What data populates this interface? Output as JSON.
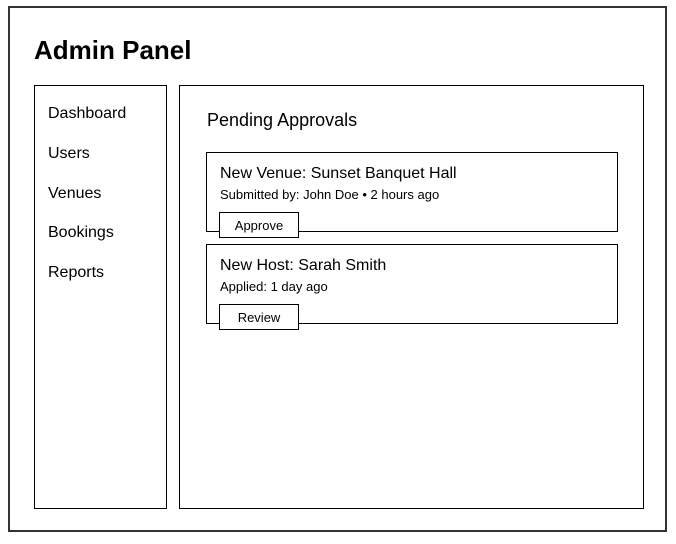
{
  "app": {
    "title": "Admin Panel"
  },
  "sidebar": {
    "items": [
      {
        "label": "Dashboard"
      },
      {
        "label": "Users"
      },
      {
        "label": "Venues"
      },
      {
        "label": "Bookings"
      },
      {
        "label": "Reports"
      }
    ]
  },
  "main": {
    "section_title": "Pending Approvals",
    "cards": [
      {
        "title": "New Venue: Sunset Banquet Hall",
        "meta": "Submitted by: John Doe • 2 hours ago",
        "action_label": "Approve"
      },
      {
        "title": "New Host: Sarah Smith",
        "meta": "Applied: 1 day ago",
        "action_label": "Review"
      }
    ]
  }
}
